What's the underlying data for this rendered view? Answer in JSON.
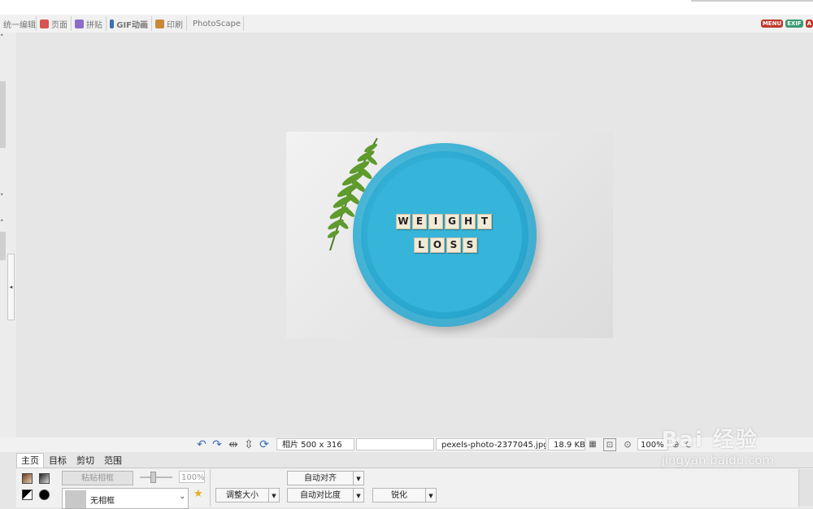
{
  "tabs": [
    {
      "label": "统一编辑",
      "icon": "folder-icon"
    },
    {
      "label": "页面",
      "icon": "page-icon"
    },
    {
      "label": "拼贴",
      "icon": "combine-icon"
    },
    {
      "label": "GIF动画",
      "icon": "gif-icon"
    },
    {
      "label": "印刷",
      "icon": "print-icon"
    },
    {
      "label": "PhotoScape",
      "icon": "photoscape-icon"
    }
  ],
  "badges": {
    "menu": "MENU",
    "exif": "EXIF",
    "more": "A"
  },
  "photo": {
    "line1": [
      "W",
      "E",
      "I",
      "G",
      "H",
      "T"
    ],
    "line2": [
      "L",
      "O",
      "S",
      "S"
    ]
  },
  "status": {
    "photo_size": "相片 500 x 316",
    "empty": "",
    "filename": "pexels-photo-2377045.jpg",
    "filesize": "18.9 KB",
    "zoom": "100%"
  },
  "panel_tabs": [
    "主页",
    "目标",
    "剪切",
    "范围"
  ],
  "panel": {
    "paste_frame": "粘贴相框",
    "opacity": "100%",
    "frame": "无相框",
    "resize": "调整大小",
    "auto_level": "自动对齐",
    "auto_contrast": "自动对比度",
    "sharpen": "锐化"
  },
  "watermark": {
    "brand": "Bai 经验",
    "url": "jingyan.baidu.com"
  }
}
